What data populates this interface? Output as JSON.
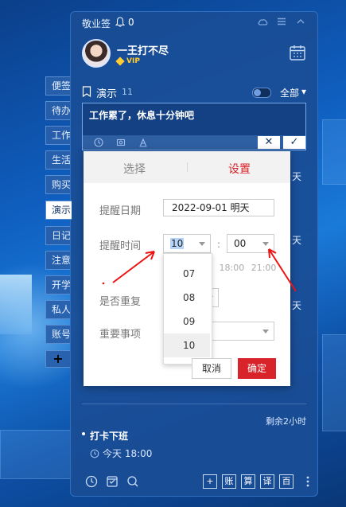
{
  "app": {
    "name": "敬业签",
    "notification_count": "0"
  },
  "titlebar_icons": [
    "cloud-icon",
    "menu-icon",
    "collapse-icon"
  ],
  "user": {
    "name": "一王打不尽",
    "badge": "VIP"
  },
  "list": {
    "title": "演示",
    "count": "11",
    "filter_label": "全部"
  },
  "input": {
    "text": "工作累了，休息十分钟吧",
    "cancel_label": "✕",
    "confirm_label": "✓"
  },
  "side_tabs": [
    "便签",
    "待办",
    "工作",
    "生活",
    "购买",
    "演示",
    "日记",
    "注意",
    "开学",
    "私人",
    "账号"
  ],
  "side_tabs_add": "+",
  "background_items": {
    "right_fragment_1": "天",
    "right_fragment_2": "天",
    "right_fragment_3": "天"
  },
  "remaining": "剩余2小时",
  "task": {
    "title": "打卡下班",
    "time": "今天 18:00"
  },
  "bottom_bar": {
    "buttons": [
      "+",
      "账",
      "算",
      "译",
      "百"
    ]
  },
  "dialog": {
    "tab_select": "选择",
    "tab_settings": "设置",
    "date_label": "提醒日期",
    "date_value": "2022-09-01 明天",
    "time_label": "提醒时间",
    "hour_value": "10",
    "minute_value": "00",
    "colon": ":",
    "quick_times": "0  18:00  21:00",
    "repeat_label": "是否重复",
    "important_label": "重要事项",
    "hour_options": [
      "07",
      "08",
      "09",
      "10"
    ],
    "selected_hour": "10",
    "cancel_label": "取消",
    "confirm_label": "确定"
  },
  "colors": {
    "accent_red": "#d9232a",
    "panel_blue": "#1a4e96",
    "vip_gold": "#ffcc33"
  }
}
